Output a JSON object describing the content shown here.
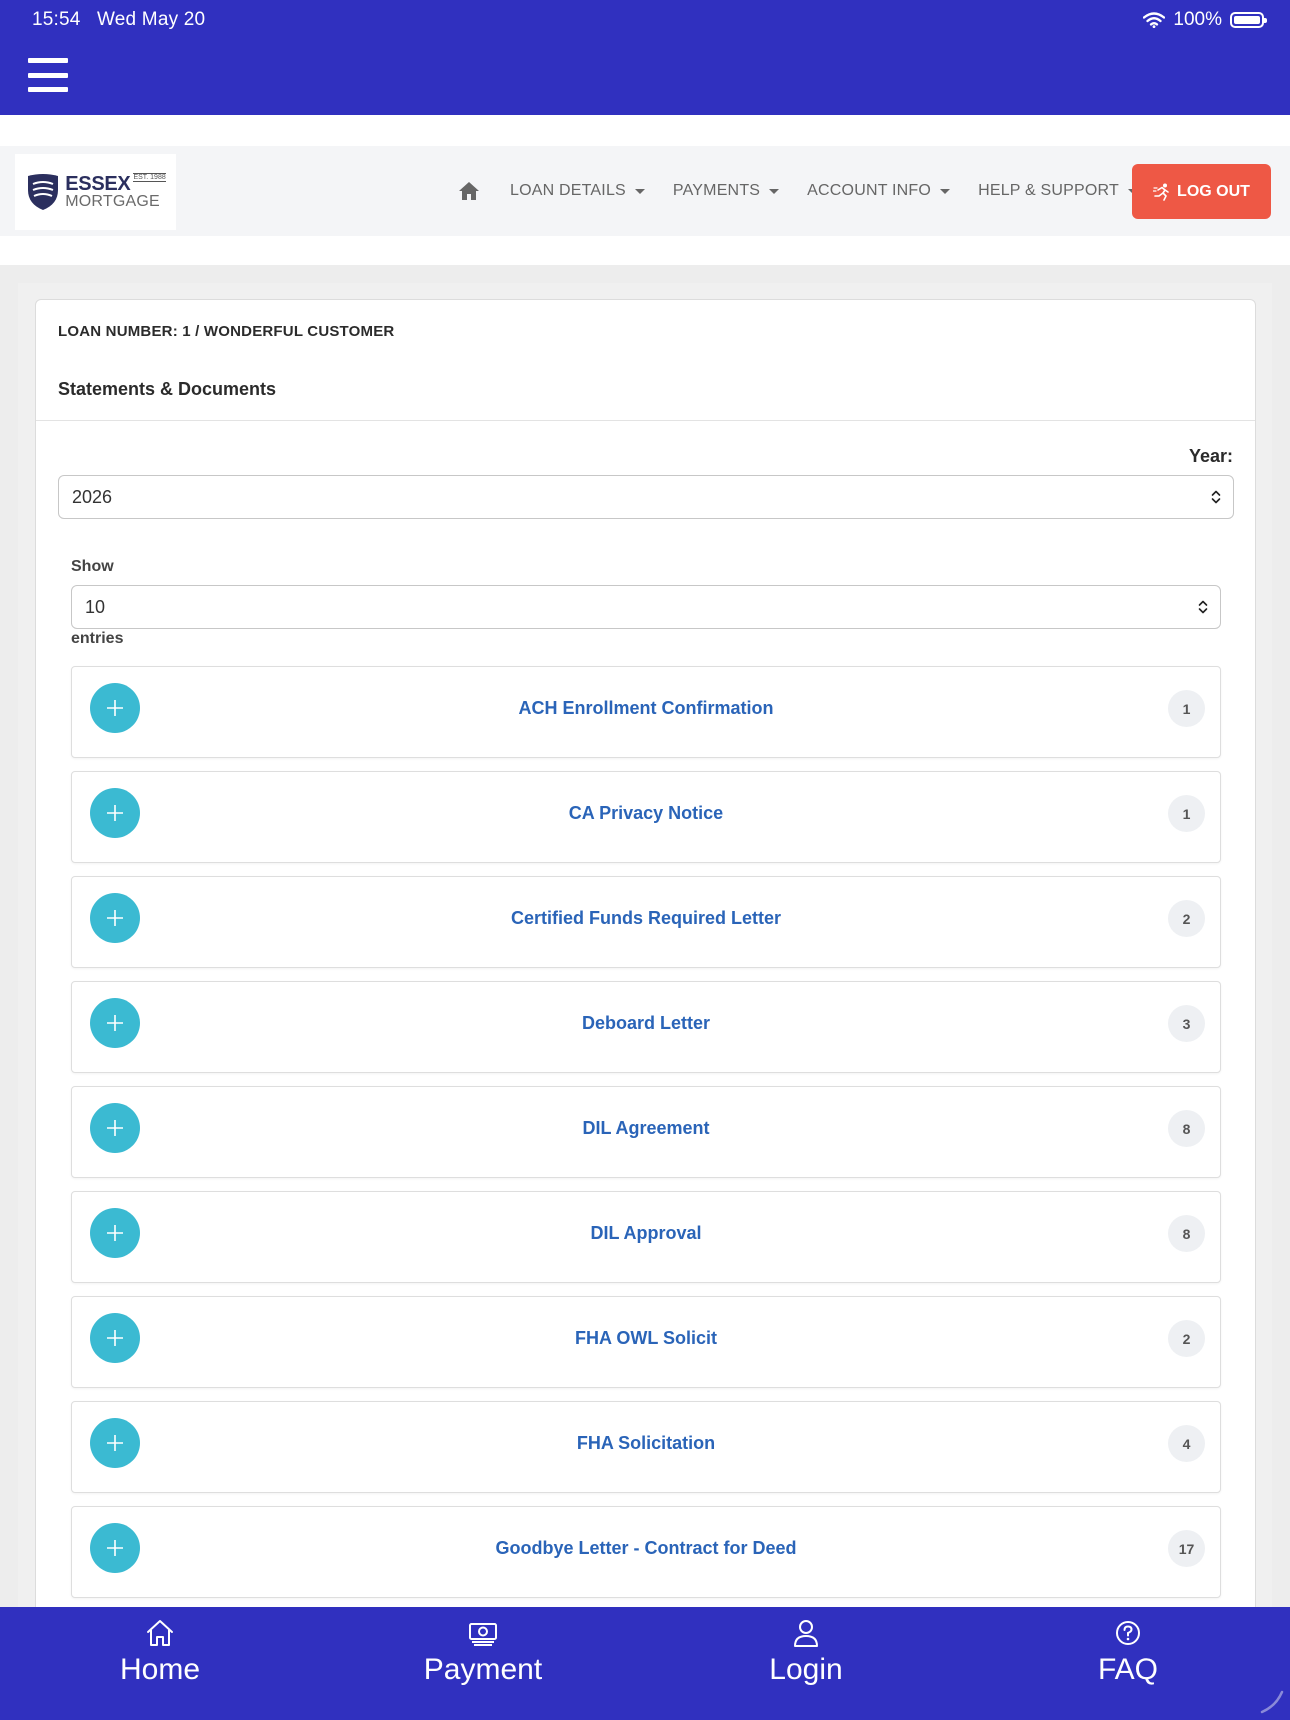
{
  "status_bar": {
    "time": "15:54",
    "date": "Wed May 20",
    "battery": "100%"
  },
  "brand": {
    "name": "ESSEX",
    "est": "EST. 1988",
    "sub": "MORTGAGE"
  },
  "nav": {
    "home_icon": "home-icon",
    "items": [
      {
        "label": "LOAN DETAILS"
      },
      {
        "label": "PAYMENTS"
      },
      {
        "label": "ACCOUNT INFO"
      },
      {
        "label": "HELP & SUPPORT"
      }
    ],
    "logout_label": "LOG OUT"
  },
  "card": {
    "loan_number": "LOAN NUMBER: 1 / WONDERFUL CUSTOMER",
    "title": "Statements & Documents",
    "year_label": "Year:",
    "year_value": "2026",
    "show_label": "Show",
    "entries_value": "10",
    "entries_label": "entries"
  },
  "documents": [
    {
      "name": "ACH Enrollment Confirmation",
      "count": "1"
    },
    {
      "name": "CA Privacy Notice",
      "count": "1"
    },
    {
      "name": "Certified Funds Required Letter",
      "count": "2"
    },
    {
      "name": "Deboard Letter",
      "count": "3"
    },
    {
      "name": "DIL Agreement",
      "count": "8"
    },
    {
      "name": "DIL Approval",
      "count": "8"
    },
    {
      "name": "FHA OWL Solicit",
      "count": "2"
    },
    {
      "name": "FHA Solicitation",
      "count": "4"
    },
    {
      "name": "Goodbye Letter - Contract for Deed",
      "count": "17"
    }
  ],
  "tabbar": {
    "home": "Home",
    "payment": "Payment",
    "login": "Login",
    "faq": "FAQ"
  },
  "colors": {
    "primary": "#3030bf",
    "logout": "#ee5845",
    "plus": "#3bbad2",
    "link": "#2a64b8"
  }
}
